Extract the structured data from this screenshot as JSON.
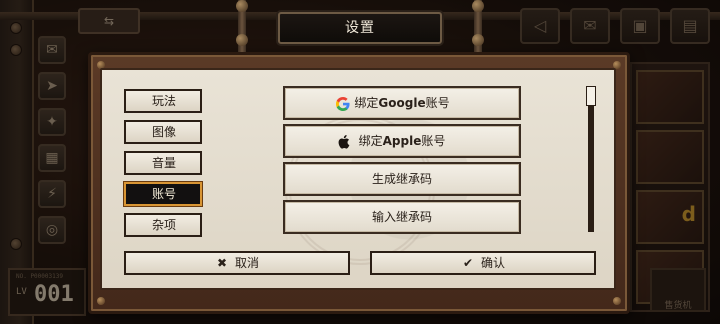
{
  "background": {
    "left_rail_icons": [
      "mail-icon",
      "send-icon",
      "map-icon",
      "map-icon",
      "lightning-icon",
      "globe-icon"
    ],
    "top_tab_icon": "⇆",
    "right_icons": [
      "megaphone-icon",
      "envelope-icon",
      "gift-icon",
      "cabinet-icon"
    ],
    "level": {
      "tiny": "NO. P00003139",
      "lv_label": "LV",
      "value": "001"
    },
    "machine_label": "售货机",
    "right_panel_text": "d"
  },
  "dialog": {
    "title": "设置",
    "tabs": [
      {
        "label": "玩法",
        "active": false
      },
      {
        "label": "图像",
        "active": false
      },
      {
        "label": "音量",
        "active": false
      },
      {
        "label": "账号",
        "active": true
      },
      {
        "label": "杂项",
        "active": false
      }
    ],
    "actions": [
      {
        "prefix": "绑定",
        "brand": "Google",
        "suffix": "账号",
        "icon": "google-icon"
      },
      {
        "prefix": "绑定",
        "brand": "Apple",
        "suffix": "账号",
        "icon": "apple-icon"
      },
      {
        "prefix": "",
        "brand": "",
        "suffix": "生成继承码",
        "icon": ""
      },
      {
        "prefix": "",
        "brand": "",
        "suffix": "输入继承码",
        "icon": ""
      }
    ],
    "cancel_label": "取消",
    "cancel_glyph": "✖",
    "confirm_label": "确认",
    "confirm_glyph": "✔"
  },
  "colors": {
    "active_tab_border": "#d89534",
    "panel_bg": "#e9e3d6",
    "frame": "#5b3a26"
  }
}
